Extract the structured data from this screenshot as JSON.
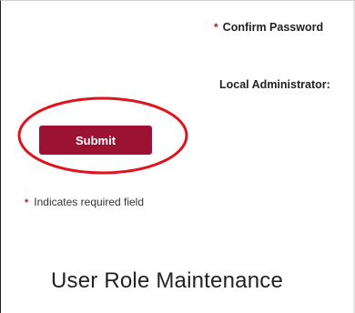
{
  "form": {
    "confirm_password_label": "Confirm Password",
    "local_admin_label": "Local Administrator:",
    "required_marker": "*",
    "submit_label": "Submit",
    "required_note": "Indicates required field"
  },
  "section": {
    "title": "User Role Maintenance"
  },
  "colors": {
    "accent": "#9c1232",
    "required_star": "#b8162a",
    "annotation_ring": "#e0141e"
  }
}
